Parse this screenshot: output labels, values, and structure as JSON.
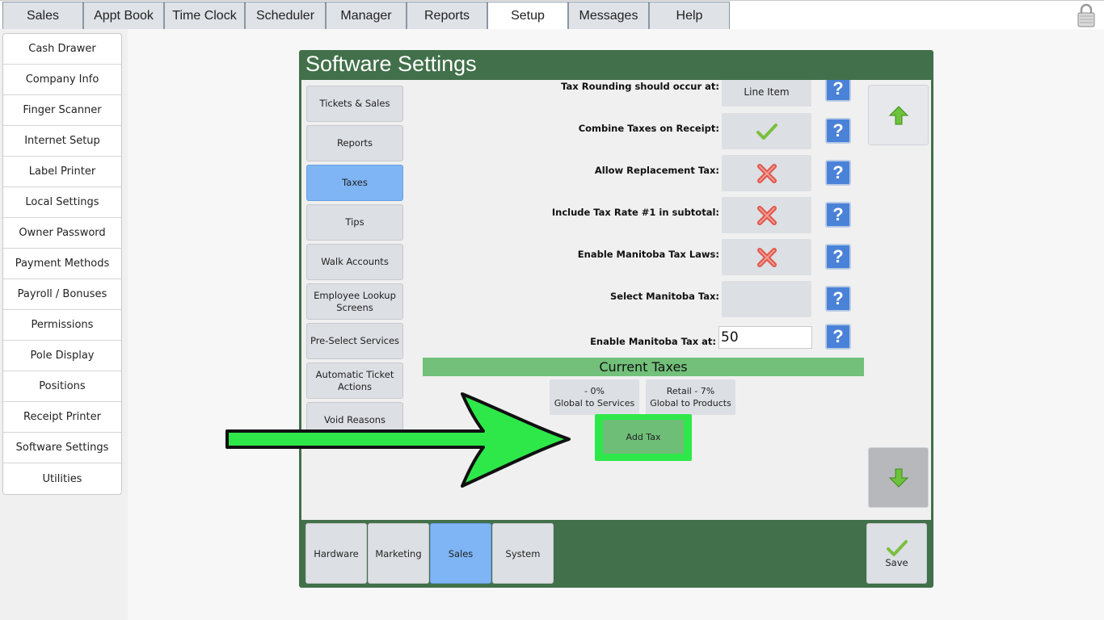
{
  "top_tabs": [
    "Sales",
    "Appt Book",
    "Time Clock",
    "Scheduler",
    "Manager",
    "Reports",
    "Setup",
    "Messages",
    "Help"
  ],
  "active_tab": "Setup",
  "sidebar": {
    "items": [
      "Cash Drawer",
      "Company Info",
      "Finger Scanner",
      "Internet Setup",
      "Label Printer",
      "Local Settings",
      "Owner Password",
      "Payment Methods",
      "Payroll / Bonuses",
      "Permissions",
      "Pole Display",
      "Positions",
      "Receipt Printer",
      "Software Settings",
      "Utilities"
    ]
  },
  "panel": {
    "title": "Software Settings",
    "categories": [
      "Tickets & Sales",
      "Reports",
      "Taxes",
      "Tips",
      "Walk Accounts",
      "Employee Lookup Screens",
      "Pre-Select Services",
      "Automatic Ticket Actions",
      "Void Reasons"
    ],
    "active_category": "Taxes",
    "settings": [
      {
        "label": "Tax Rounding should occur at:",
        "value": "Line Item",
        "state": "text"
      },
      {
        "label": "Combine Taxes on Receipt:",
        "value": "",
        "state": "check"
      },
      {
        "label": "Allow Replacement Tax:",
        "value": "",
        "state": "cross"
      },
      {
        "label": "Include Tax Rate #1 in subtotal:",
        "value": "",
        "state": "cross"
      },
      {
        "label": "Enable Manitoba Tax Laws:",
        "value": "",
        "state": "cross"
      },
      {
        "label": "Select Manitoba Tax:",
        "value": "",
        "state": "empty"
      },
      {
        "label": "Enable Manitoba Tax at:",
        "value": "50",
        "state": "input"
      }
    ],
    "help_glyph": "?",
    "current_taxes_heading": "Current Taxes",
    "taxes": [
      {
        "line1": "- 0%",
        "line2": "Global to Services"
      },
      {
        "line1": "Retail - 7%",
        "line2": "Global to Products"
      }
    ],
    "add_tax_label": "Add Tax",
    "bottom_tabs": [
      "Hardware",
      "Marketing",
      "Sales",
      "System"
    ],
    "active_bottom_tab": "Sales",
    "save_label": "Save"
  },
  "colors": {
    "panel_green": "#42704a",
    "active_blue": "#7fb5f5",
    "highlight_green": "#2ee84a",
    "current_taxes_bar": "#72c07a"
  }
}
